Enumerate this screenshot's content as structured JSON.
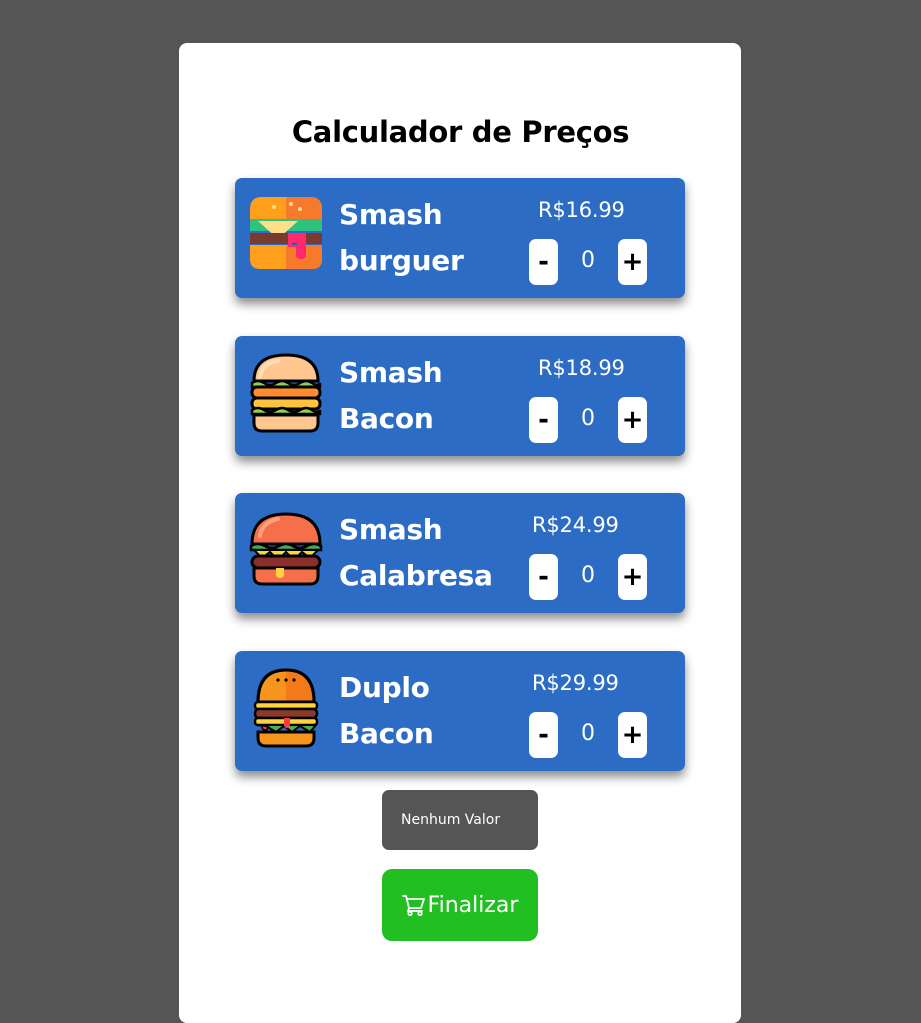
{
  "title": "Calculador de Preços",
  "products": [
    {
      "name": "Smash\nburguer",
      "price": "R$16.99",
      "quantity": "0",
      "icon": "burger-icon"
    },
    {
      "name": "Smash\nBacon",
      "price": "R$18.99",
      "quantity": "0",
      "icon": "bacon-burger-icon"
    },
    {
      "name": "Smash\nCalabresa",
      "price": "R$24.99",
      "quantity": "0",
      "icon": "calabresa-burger-icon"
    },
    {
      "name": "Duplo\nBacon",
      "price": "R$29.99",
      "quantity": "0",
      "icon": "double-burger-icon"
    }
  ],
  "controls": {
    "minus_label": "-",
    "plus_label": "+"
  },
  "total": {
    "label": "Nenhum Valor"
  },
  "finish": {
    "label": "Finalizar",
    "icon": "cart-icon"
  },
  "colors": {
    "background": "#555555",
    "card": "#ffffff",
    "product_bg": "#2d6cc5",
    "finish_button": "#22bf22",
    "total_box": "#555555"
  }
}
